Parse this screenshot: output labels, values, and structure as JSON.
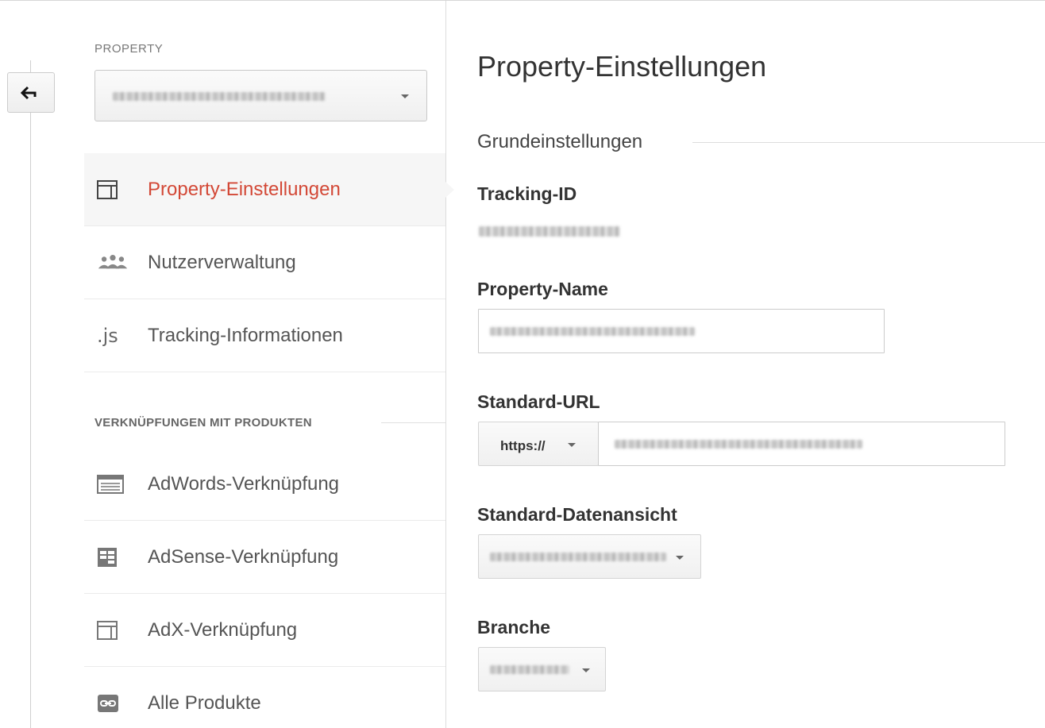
{
  "sidebar": {
    "section_property": "PROPERTY",
    "property_select_value": "",
    "items": [
      {
        "label": "Property-Einstellungen",
        "icon": "layout-icon",
        "active": true
      },
      {
        "label": "Nutzerverwaltung",
        "icon": "users-icon",
        "active": false
      },
      {
        "label": "Tracking-Informationen",
        "icon": "js-icon",
        "active": false
      }
    ],
    "section_products": "VERKNÜPFUNGEN MIT PRODUKTEN",
    "product_items": [
      {
        "label": "AdWords-Verknüpfung",
        "icon": "adwords-icon"
      },
      {
        "label": "AdSense-Verknüpfung",
        "icon": "adsense-icon"
      },
      {
        "label": "AdX-Verknüpfung",
        "icon": "adx-icon"
      },
      {
        "label": "Alle Produkte",
        "icon": "link-icon"
      }
    ],
    "js_glyph": ".js"
  },
  "main": {
    "title": "Property-Einstellungen",
    "subsection": "Grundeinstellungen",
    "tracking_id_label": "Tracking-ID",
    "property_name_label": "Property-Name",
    "default_url_label": "Standard-URL",
    "protocol_value": "https://",
    "default_view_label": "Standard-Datenansicht",
    "industry_label": "Branche"
  },
  "colors": {
    "accent": "#d34836",
    "border": "#cccccc"
  }
}
